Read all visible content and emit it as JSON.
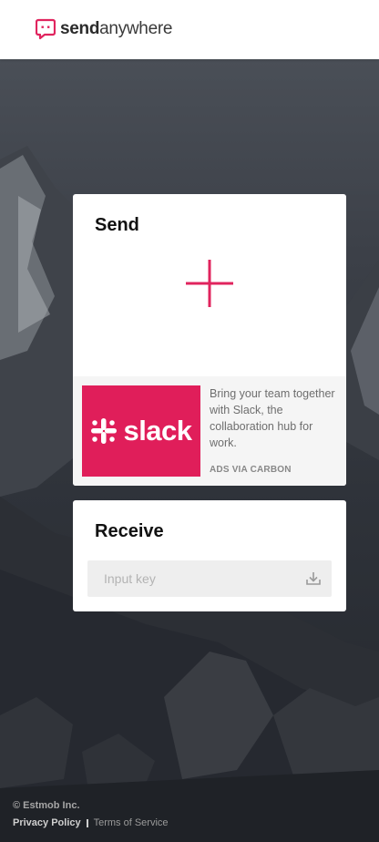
{
  "brand": {
    "name_bold": "send",
    "name_light": "anywhere",
    "accent_color": "#e0245e",
    "logo_icon": "send-anywhere-logo-icon"
  },
  "send": {
    "title": "Send",
    "add_icon": "plus-icon"
  },
  "ad": {
    "image_brand": "slack",
    "image_color": "#e01e5a",
    "text": "Bring your team together with Slack, the collaboration hub for work.",
    "via": "ADS VIA CARBON"
  },
  "receive": {
    "title": "Receive",
    "input_placeholder": "Input key",
    "input_value": "",
    "download_icon": "download-icon"
  },
  "footer": {
    "copyright": "© Estmob Inc.",
    "privacy": "Privacy Policy",
    "terms": "Terms of Service"
  }
}
